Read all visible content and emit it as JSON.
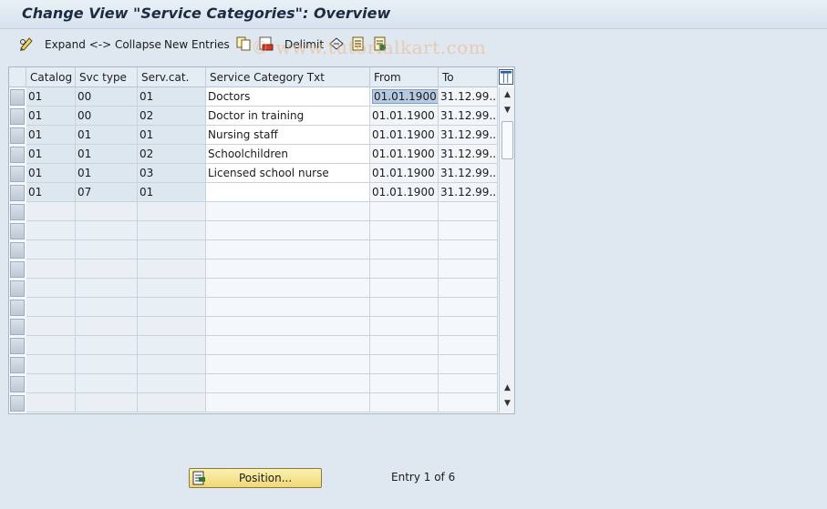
{
  "title": "Change View \"Service Categories\": Overview",
  "toolbar": {
    "expand_collapse_label": "Expand <-> Collapse",
    "new_entries_label": "New Entries",
    "delimit_label": "Delimit"
  },
  "watermark": "© www.tutorialkart.com",
  "table": {
    "columns": [
      "Catalog",
      "Svc type",
      "Serv.cat.",
      "Service Category Txt",
      "From",
      "To"
    ],
    "rows": [
      [
        "01",
        "00",
        "01",
        "Doctors",
        "01.01.1900",
        "31.12.99.."
      ],
      [
        "01",
        "00",
        "02",
        "Doctor in training",
        "01.01.1900",
        "31.12.99.."
      ],
      [
        "01",
        "01",
        "01",
        "Nursing staff",
        "01.01.1900",
        "31.12.99.."
      ],
      [
        "01",
        "01",
        "02",
        "Schoolchildren",
        "01.01.1900",
        "31.12.99.."
      ],
      [
        "01",
        "01",
        "03",
        "Licensed school nurse",
        "01.01.1900",
        "31.12.99.."
      ],
      [
        "01",
        "07",
        "01",
        "",
        "01.01.1900",
        "31.12.99.."
      ]
    ]
  },
  "footer": {
    "position_button": "Position...",
    "entry_info": "Entry 1 of 6"
  },
  "icons": {
    "edit": "pencil-glasses-icon",
    "copy": "copy-icon",
    "delete": "delete-icon",
    "undo": "undo-icon",
    "select_all": "select-all-icon",
    "deselect": "select-block-icon",
    "table_settings": "table-settings-icon",
    "position": "position-icon"
  }
}
